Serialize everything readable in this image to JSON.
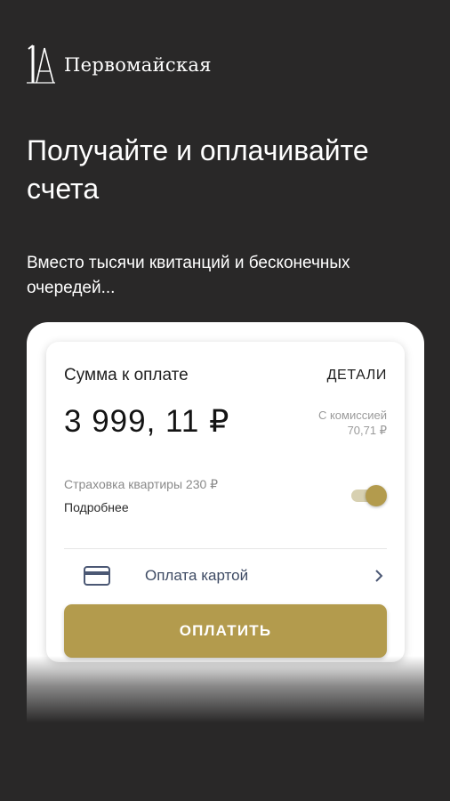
{
  "colors": {
    "background": "#292828",
    "accent_gold": "#b39b4d",
    "toggle_track": "#d7d0b1",
    "card_icon": "#4b5874"
  },
  "header": {
    "logo_icon": "ia-monogram-icon",
    "logo_text": "Первомайская"
  },
  "onboarding": {
    "title": "Получайте и оплачивайте счета",
    "subtitle": "Вместо тысячи квитанций и бесконечных очередей..."
  },
  "payment_card": {
    "title": "Сумма к оплате",
    "details_label": "ДЕТАЛИ",
    "amount": "3 999, 11 ₽",
    "commission_label": "С комиссией",
    "commission_value": "70,71 ₽",
    "insurance_text": "Страховка квартиры 230 ₽",
    "more_link": "Подробнее",
    "insurance_toggle_on": true,
    "payment_method": {
      "icon": "credit-card-icon",
      "label": "Оплата картой"
    },
    "pay_button": "ОПЛАТИТЬ"
  }
}
